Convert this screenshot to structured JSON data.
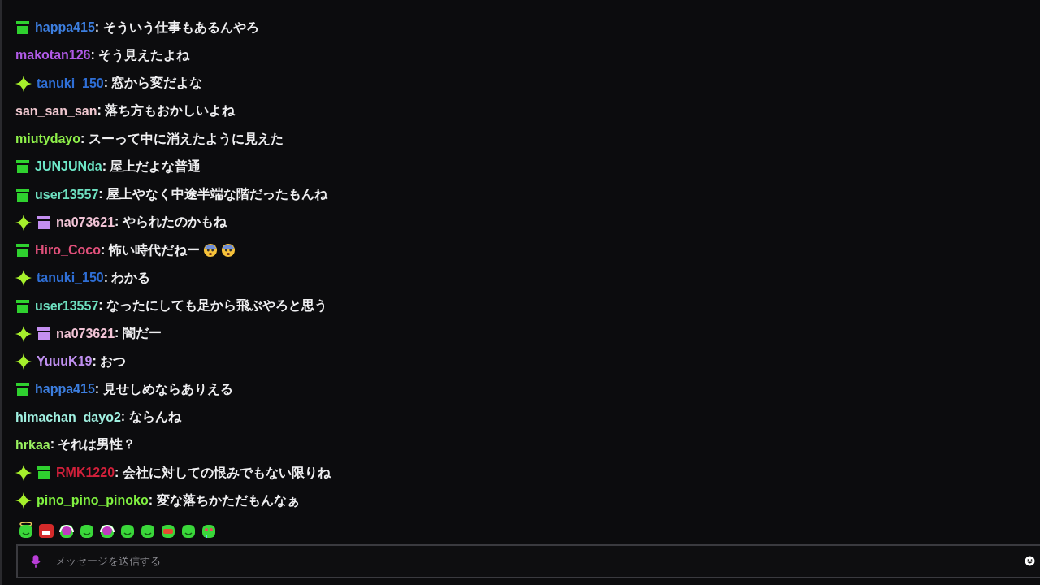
{
  "messages": [
    {
      "badges": [
        {
          "kind": "gift-green"
        }
      ],
      "user": "happa415",
      "color": "#3d7fe0",
      "text": ": そういう仕事もあるんやろ"
    },
    {
      "user": "makotan126",
      "color": "#b05ae6",
      "text": ": そう見えたよね"
    },
    {
      "badges": [
        {
          "kind": "sparkle"
        }
      ],
      "user": "tanuki_150",
      "color": "#2f6fd6",
      "text": ": 窓から変だよな"
    },
    {
      "user": "san_san_san",
      "color": "#f0c8d0",
      "text": ": 落ち方もおかしいよね"
    },
    {
      "user": "miutydayo",
      "color": "#8ef04a",
      "text": ": スーって中に消えたように見えた"
    },
    {
      "badges": [
        {
          "kind": "gift-green"
        }
      ],
      "user": "JUNJUNda",
      "color": "#6ee8c8",
      "text": ": 屋上だよな普通"
    },
    {
      "badges": [
        {
          "kind": "gift-green"
        }
      ],
      "user": "user13557",
      "color": "#6ee0c0",
      "text": ": 屋上やなく中途半端な階だったもんね"
    },
    {
      "badges": [
        {
          "kind": "sparkle"
        },
        {
          "kind": "gift-purple"
        }
      ],
      "user": "na073621",
      "color": "#f2c4d6",
      "text": ": やられたのかもね"
    },
    {
      "badges": [
        {
          "kind": "gift-green"
        }
      ],
      "user": "Hiro_Coco",
      "color": "#e0507a",
      "text": ": 怖い時代だねー",
      "emotes": [
        {
          "kind": "fearful"
        },
        {
          "kind": "fearful"
        }
      ]
    },
    {
      "badges": [
        {
          "kind": "sparkle"
        }
      ],
      "user": "tanuki_150",
      "color": "#2f6fd6",
      "text": ": わかる"
    },
    {
      "badges": [
        {
          "kind": "gift-green"
        }
      ],
      "user": "user13557",
      "color": "#6ee0c0",
      "text": ": なったにしても足から飛ぶやろと思う"
    },
    {
      "badges": [
        {
          "kind": "sparkle"
        },
        {
          "kind": "gift-purple"
        }
      ],
      "user": "na073621",
      "color": "#f2c4d6",
      "text": ": 闇だー"
    },
    {
      "badges": [
        {
          "kind": "sparkle"
        }
      ],
      "user": "YuuuK19",
      "color": "#c090f0",
      "text": ": おつ"
    },
    {
      "badges": [
        {
          "kind": "gift-green"
        }
      ],
      "user": "happa415",
      "color": "#3d7fe0",
      "text": ": 見せしめならありえる"
    },
    {
      "user": "himachan_dayo2",
      "color": "#a0f0e0",
      "text": ": ならんね"
    },
    {
      "user": "hrkaa",
      "color": "#9af060",
      "text": ": それは男性？"
    },
    {
      "badges": [
        {
          "kind": "sparkle"
        },
        {
          "kind": "gift-green"
        }
      ],
      "user": "RMK1220",
      "color": "#d0203a",
      "text": ": 会社に対しての恨みでもない限りね"
    },
    {
      "badges": [
        {
          "kind": "sparkle"
        }
      ],
      "user": "pino_pino_pinoko",
      "color": "#80f040",
      "text": ": 変な落ちかただもんなぁ"
    }
  ],
  "emote_bar": [
    {
      "kind": "halo"
    },
    {
      "kind": "angry"
    },
    {
      "kind": "headphones"
    },
    {
      "kind": "grin"
    },
    {
      "kind": "headphones"
    },
    {
      "kind": "smile"
    },
    {
      "kind": "smile"
    },
    {
      "kind": "mustache"
    },
    {
      "kind": "smile"
    },
    {
      "kind": "drool"
    }
  ],
  "input": {
    "placeholder": "メッセージを送信する"
  }
}
